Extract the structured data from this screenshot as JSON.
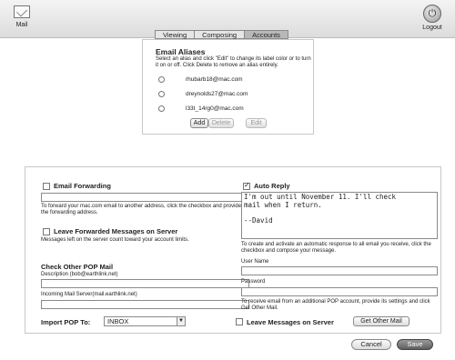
{
  "header": {
    "mail_label": "Mail",
    "logout_label": "Logout"
  },
  "tabs": [
    {
      "label": "Viewing"
    },
    {
      "label": "Composing"
    },
    {
      "label": "Accounts"
    }
  ],
  "aliases": {
    "title": "Email Aliases",
    "description": "Select an alias and click \"Edit\" to change its label color or to turn it on or off. Click Delete to remove an alias entirely.",
    "items": [
      {
        "address": "rhubarb18@mac.com"
      },
      {
        "address": "dreynolds27@mac.com"
      },
      {
        "address": "l33t_14rg0@mac.com"
      }
    ],
    "add_label": "Add",
    "delete_label": "Delete",
    "edit_label": "Edit"
  },
  "forwarding": {
    "title": "Email Forwarding",
    "description": "To forward your mac.com email to another address, click the checkbox and provide the forwarding address.",
    "leave_label": "Leave Forwarded Messages on Server",
    "leave_desc": "Messages left on the server count toward your account limits."
  },
  "pop": {
    "title": "Check Other POP Mail",
    "description_label": "Description (bob@earthlink.net)",
    "server_label": "Incoming Mail Server(mail.earthlink.net)",
    "import_label": "Import POP To:",
    "import_value": "INBOX",
    "username_label": "User Name",
    "password_label": "Password",
    "info": "To receive email from an additional POP account, provide its settings and click Get Other Mail.",
    "leave_label": "Leave Messages on Server",
    "get_label": "Get Other Mail"
  },
  "autoreply": {
    "title": "Auto Reply",
    "message": "I'm out until November 11. I'll check\nmail when I return.\n\n--David",
    "description": "To create and activate an automatic response to all email you receive, click the checkbox and compose your message."
  },
  "footer": {
    "cancel_label": "Cancel",
    "save_label": "Save"
  }
}
